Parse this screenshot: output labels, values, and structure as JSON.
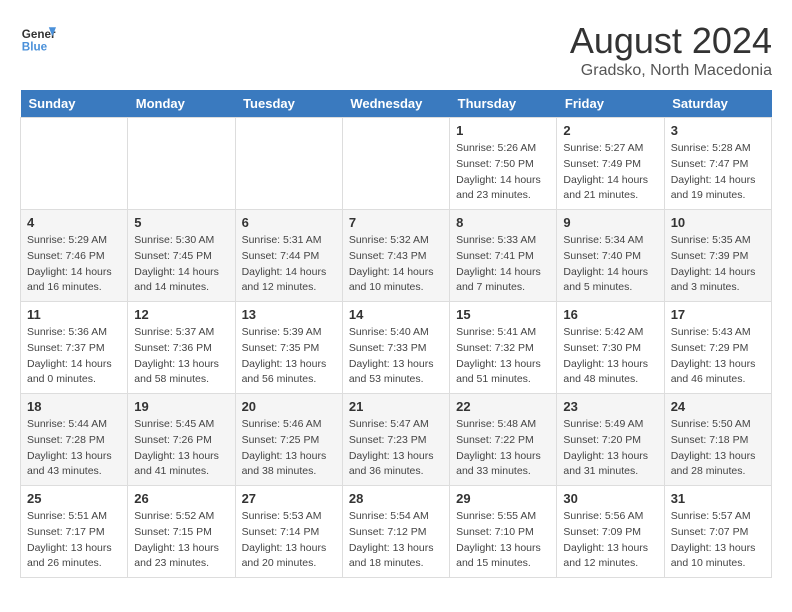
{
  "header": {
    "logo_line1": "General",
    "logo_line2": "Blue",
    "main_title": "August 2024",
    "subtitle": "Gradsko, North Macedonia"
  },
  "days_of_week": [
    "Sunday",
    "Monday",
    "Tuesday",
    "Wednesday",
    "Thursday",
    "Friday",
    "Saturday"
  ],
  "weeks": [
    {
      "days": [
        {
          "number": "",
          "sunrise": "",
          "sunset": "",
          "daylight": ""
        },
        {
          "number": "",
          "sunrise": "",
          "sunset": "",
          "daylight": ""
        },
        {
          "number": "",
          "sunrise": "",
          "sunset": "",
          "daylight": ""
        },
        {
          "number": "",
          "sunrise": "",
          "sunset": "",
          "daylight": ""
        },
        {
          "number": "1",
          "sunrise": "5:26 AM",
          "sunset": "7:50 PM",
          "daylight": "14 hours and 23 minutes."
        },
        {
          "number": "2",
          "sunrise": "5:27 AM",
          "sunset": "7:49 PM",
          "daylight": "14 hours and 21 minutes."
        },
        {
          "number": "3",
          "sunrise": "5:28 AM",
          "sunset": "7:47 PM",
          "daylight": "14 hours and 19 minutes."
        }
      ]
    },
    {
      "days": [
        {
          "number": "4",
          "sunrise": "5:29 AM",
          "sunset": "7:46 PM",
          "daylight": "14 hours and 16 minutes."
        },
        {
          "number": "5",
          "sunrise": "5:30 AM",
          "sunset": "7:45 PM",
          "daylight": "14 hours and 14 minutes."
        },
        {
          "number": "6",
          "sunrise": "5:31 AM",
          "sunset": "7:44 PM",
          "daylight": "14 hours and 12 minutes."
        },
        {
          "number": "7",
          "sunrise": "5:32 AM",
          "sunset": "7:43 PM",
          "daylight": "14 hours and 10 minutes."
        },
        {
          "number": "8",
          "sunrise": "5:33 AM",
          "sunset": "7:41 PM",
          "daylight": "14 hours and 7 minutes."
        },
        {
          "number": "9",
          "sunrise": "5:34 AM",
          "sunset": "7:40 PM",
          "daylight": "14 hours and 5 minutes."
        },
        {
          "number": "10",
          "sunrise": "5:35 AM",
          "sunset": "7:39 PM",
          "daylight": "14 hours and 3 minutes."
        }
      ]
    },
    {
      "days": [
        {
          "number": "11",
          "sunrise": "5:36 AM",
          "sunset": "7:37 PM",
          "daylight": "14 hours and 0 minutes."
        },
        {
          "number": "12",
          "sunrise": "5:37 AM",
          "sunset": "7:36 PM",
          "daylight": "13 hours and 58 minutes."
        },
        {
          "number": "13",
          "sunrise": "5:39 AM",
          "sunset": "7:35 PM",
          "daylight": "13 hours and 56 minutes."
        },
        {
          "number": "14",
          "sunrise": "5:40 AM",
          "sunset": "7:33 PM",
          "daylight": "13 hours and 53 minutes."
        },
        {
          "number": "15",
          "sunrise": "5:41 AM",
          "sunset": "7:32 PM",
          "daylight": "13 hours and 51 minutes."
        },
        {
          "number": "16",
          "sunrise": "5:42 AM",
          "sunset": "7:30 PM",
          "daylight": "13 hours and 48 minutes."
        },
        {
          "number": "17",
          "sunrise": "5:43 AM",
          "sunset": "7:29 PM",
          "daylight": "13 hours and 46 minutes."
        }
      ]
    },
    {
      "days": [
        {
          "number": "18",
          "sunrise": "5:44 AM",
          "sunset": "7:28 PM",
          "daylight": "13 hours and 43 minutes."
        },
        {
          "number": "19",
          "sunrise": "5:45 AM",
          "sunset": "7:26 PM",
          "daylight": "13 hours and 41 minutes."
        },
        {
          "number": "20",
          "sunrise": "5:46 AM",
          "sunset": "7:25 PM",
          "daylight": "13 hours and 38 minutes."
        },
        {
          "number": "21",
          "sunrise": "5:47 AM",
          "sunset": "7:23 PM",
          "daylight": "13 hours and 36 minutes."
        },
        {
          "number": "22",
          "sunrise": "5:48 AM",
          "sunset": "7:22 PM",
          "daylight": "13 hours and 33 minutes."
        },
        {
          "number": "23",
          "sunrise": "5:49 AM",
          "sunset": "7:20 PM",
          "daylight": "13 hours and 31 minutes."
        },
        {
          "number": "24",
          "sunrise": "5:50 AM",
          "sunset": "7:18 PM",
          "daylight": "13 hours and 28 minutes."
        }
      ]
    },
    {
      "days": [
        {
          "number": "25",
          "sunrise": "5:51 AM",
          "sunset": "7:17 PM",
          "daylight": "13 hours and 26 minutes."
        },
        {
          "number": "26",
          "sunrise": "5:52 AM",
          "sunset": "7:15 PM",
          "daylight": "13 hours and 23 minutes."
        },
        {
          "number": "27",
          "sunrise": "5:53 AM",
          "sunset": "7:14 PM",
          "daylight": "13 hours and 20 minutes."
        },
        {
          "number": "28",
          "sunrise": "5:54 AM",
          "sunset": "7:12 PM",
          "daylight": "13 hours and 18 minutes."
        },
        {
          "number": "29",
          "sunrise": "5:55 AM",
          "sunset": "7:10 PM",
          "daylight": "13 hours and 15 minutes."
        },
        {
          "number": "30",
          "sunrise": "5:56 AM",
          "sunset": "7:09 PM",
          "daylight": "13 hours and 12 minutes."
        },
        {
          "number": "31",
          "sunrise": "5:57 AM",
          "sunset": "7:07 PM",
          "daylight": "13 hours and 10 minutes."
        }
      ]
    }
  ]
}
